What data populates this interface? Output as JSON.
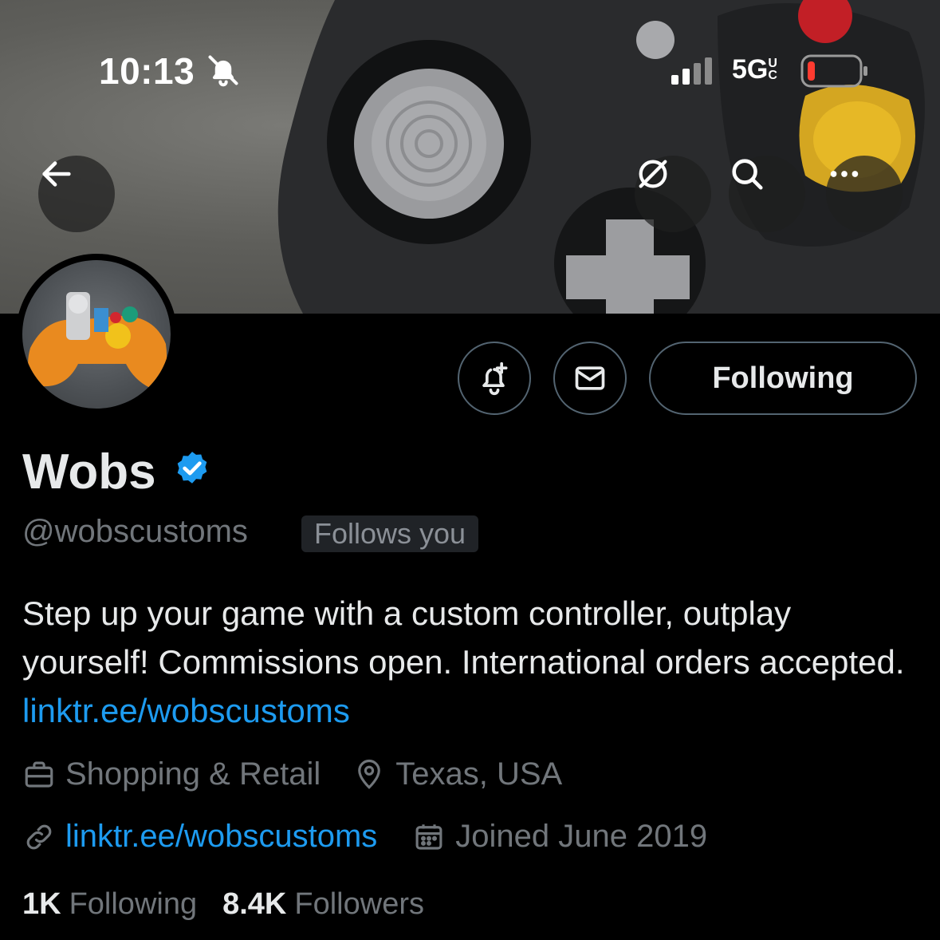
{
  "status_bar": {
    "time": "10:13",
    "network": "5G",
    "network_suffix": "UC",
    "icons": [
      "bell-slash-icon",
      "signal-icon",
      "battery-icon"
    ]
  },
  "header_actions": {
    "back": "back-arrow-icon",
    "grok": "grok-icon",
    "search": "search-icon",
    "more": "more-icon"
  },
  "profile": {
    "display_name": "Wobs",
    "handle": "@wobscustoms",
    "follows_you": "Follows you",
    "verified": true,
    "following_button": "Following",
    "bio_text": "Step up your game with a custom controller, outplay yourself! Commissions open. International orders accepted. ",
    "bio_link": "linktr.ee/wobscustoms",
    "category": "Shopping & Retail",
    "location": "Texas, USA",
    "website": "linktr.ee/wobscustoms",
    "joined": "Joined June 2019",
    "following_count": "1K",
    "following_label": "Following",
    "followers_count": "8.4K",
    "followers_label": "Followers"
  },
  "colors": {
    "accent": "#1d9bf0",
    "background": "#000000",
    "muted": "#71767b"
  }
}
